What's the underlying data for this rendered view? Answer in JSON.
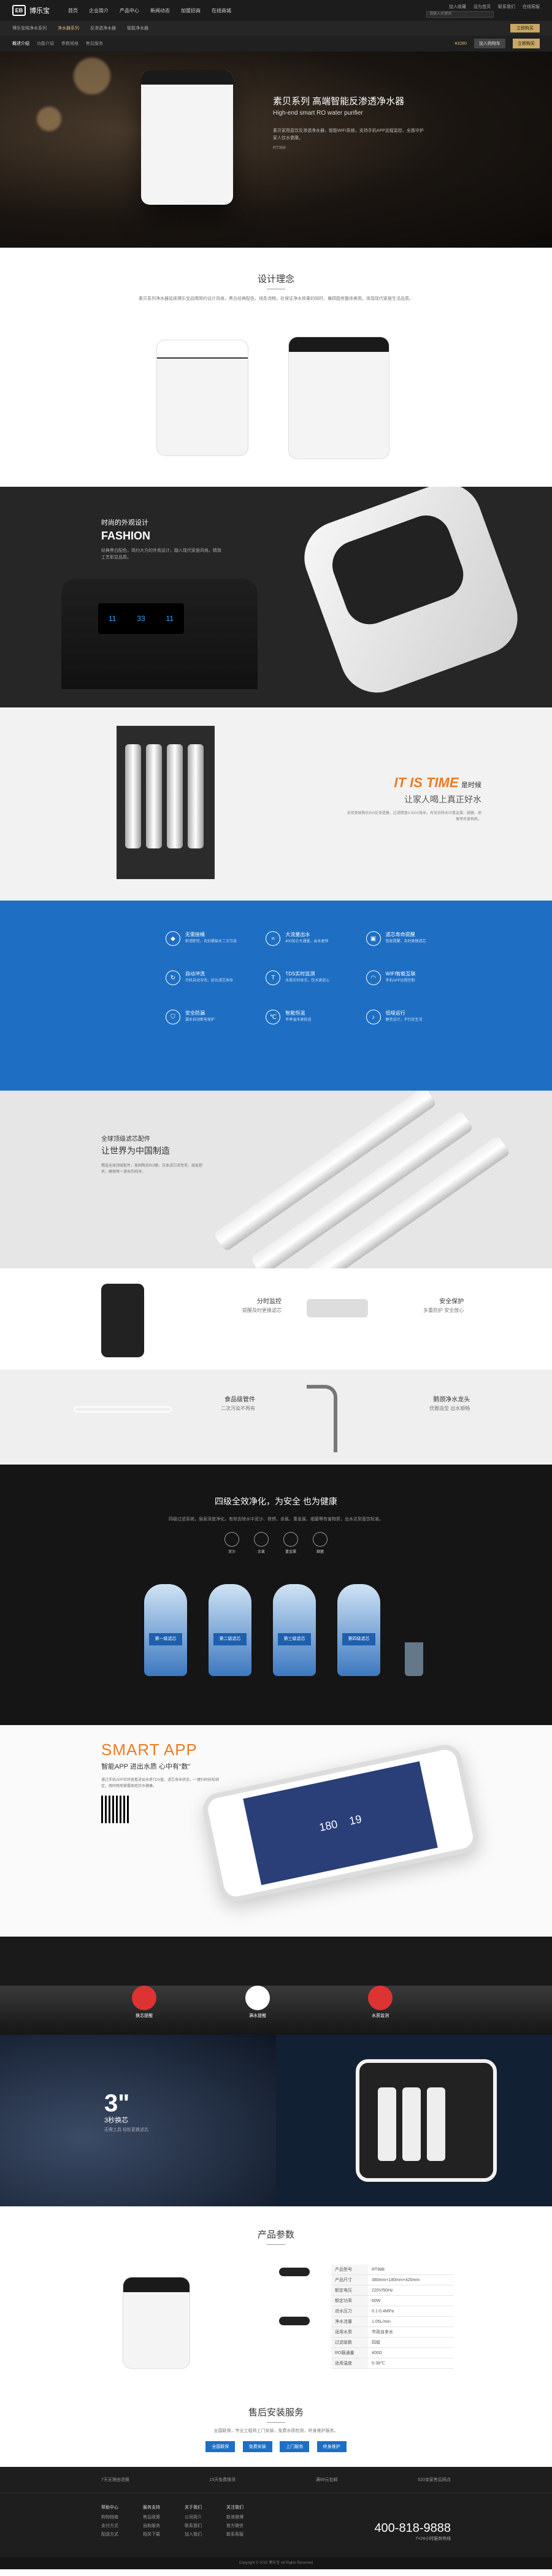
{
  "header": {
    "logo_text": "博乐宝",
    "logo_mark": "EB",
    "nav": [
      "首页",
      "企业简介",
      "产品中心",
      "新闻动态",
      "加盟招商",
      "在线商城"
    ],
    "top_right": [
      "加入收藏",
      "设为首页",
      "联系我们",
      "在线客服"
    ],
    "search_placeholder": "请输入关键词"
  },
  "subnav": {
    "items": [
      "博乐宝纯净水系列",
      "净水器系列",
      "反渗透净水器",
      "智能净水器"
    ],
    "active_index": 1,
    "buy_label": "立即购买"
  },
  "subnav2": {
    "label": "概述介绍",
    "items": [
      "功能介绍",
      "参数规格",
      "售后服务"
    ],
    "price": "¥3280",
    "btn1": "加入购物车",
    "btn2": "立即购买"
  },
  "hero": {
    "title": "素贝系列 高端智能反渗透净水器",
    "subtitle": "High-end smart RO water purifier",
    "desc": "素贝家用直饮反渗透净水器，智能WIFI系统，支持手机APP远程监控，全面守护家人饮水健康。",
    "model": "RT988"
  },
  "design": {
    "title": "设计理念",
    "desc": "素贝系列净水器延续博乐宝品牌简约设计风格，黑白经典配色，线条流畅，在保证净水效果的同时，兼顾厨房整体美观，体现现代家居生活品质。"
  },
  "fashion": {
    "title": "时尚的外观设计",
    "title_en": "FASHION",
    "desc": "经典黑白配色，简约大方的外观设计，融入现代家居风格，精致工艺彰显品质。",
    "screen_values": [
      "11",
      "33",
      "11"
    ]
  },
  "time": {
    "headline_en": "IT IS TIME",
    "headline_cn": "是时候",
    "sub": "让家人喝上真正好水",
    "desc": "采用美国陶氏RO反渗透膜，过滤精度0.0001微米，有效去除水中重金属、细菌、病毒等有害物质。"
  },
  "features": [
    {
      "icon": "drop-icon",
      "title": "无需接桶",
      "desc": "即滤即饮，告别桶装水二次污染"
    },
    {
      "icon": "water-icon",
      "title": "大流量出水",
      "desc": "400加仑大通量，出水更快"
    },
    {
      "icon": "filter-icon",
      "title": "滤芯寿命提醒",
      "desc": "智能提醒，及时更换滤芯"
    },
    {
      "icon": "wash-icon",
      "title": "自动冲洗",
      "desc": "开机自动冲洗，延长滤芯寿命"
    },
    {
      "icon": "tds-icon",
      "title": "TDS实时监测",
      "desc": "水质实时显示，饮水更放心"
    },
    {
      "icon": "wifi-icon",
      "title": "WIFI智能互联",
      "desc": "手机APP远程控制"
    },
    {
      "icon": "shield-icon",
      "title": "安全防漏",
      "desc": "漏水自动断电保护"
    },
    {
      "icon": "temp-icon",
      "title": "智能恒温",
      "desc": "冬季温水更舒适"
    },
    {
      "icon": "mute-icon",
      "title": "低噪运行",
      "desc": "静音设计，不打扰生活"
    }
  ],
  "global": {
    "title1": "全球顶级滤芯配件",
    "title2": "让世界为中国制造",
    "desc": "精选全球顶级配件，美国陶氏RO膜，日本进口活性炭，层层把关，确保每一滴水的纯净。"
  },
  "filter_row": {
    "left_title": "分时监控",
    "left_desc": "提醒及时更换滤芯",
    "right_title": "安全保护",
    "right_desc": "多重防护 安全放心"
  },
  "food_row": {
    "left_title": "食品级管件",
    "left_desc": "二次污染不再有",
    "right_title": "鹅颈净水龙头",
    "right_desc": "优雅造型 出水顺畅"
  },
  "four": {
    "title": "四级全效净化，为安全 也为健康",
    "desc": "四级过滤系统，层层深度净化，有效去除水中泥沙、铁锈、余氯、重金属、细菌等有害物质，出水达到直饮标准。",
    "icons": [
      "泥沙",
      "余氯",
      "重金属",
      "细菌"
    ],
    "stages": [
      "第一级滤芯",
      "第二级滤芯",
      "第三级滤芯",
      "第四级滤芯"
    ]
  },
  "app": {
    "title_en": "SMART APP",
    "title_cn": "智能APP 进出水质 心中有“数”",
    "desc": "通过手机APP实时查看进出水质TDS值、滤芯寿命状态，一键扫码轻松绑定，随时随地掌握家庭饮水健康。",
    "phone_values": [
      "180",
      "19"
    ]
  },
  "kitchen": {
    "items": [
      "换芯提醒",
      "满水提醒",
      "水质监测"
    ]
  },
  "three": {
    "big": "3\"",
    "title": "3秒换芯",
    "desc": "无需工具 轻松更换滤芯"
  },
  "params": {
    "title": "产品参数",
    "rows": [
      {
        "k": "产品型号",
        "v": "RT988"
      },
      {
        "k": "产品尺寸",
        "v": "380mm×180mm×420mm"
      },
      {
        "k": "额定电压",
        "v": "220V/50Hz"
      },
      {
        "k": "额定功率",
        "v": "60W"
      },
      {
        "k": "进水压力",
        "v": "0.1-0.4MPa"
      },
      {
        "k": "净水流量",
        "v": "1.05L/min"
      },
      {
        "k": "适用水质",
        "v": "市政自来水"
      },
      {
        "k": "过滤级数",
        "v": "四级"
      },
      {
        "k": "RO膜通量",
        "v": "400G"
      },
      {
        "k": "适用温度",
        "v": "5-38℃"
      }
    ]
  },
  "service": {
    "title": "售后安装服务",
    "desc": "全国联保，专业工程师上门安装，免费水质检测，终身维护服务。",
    "buttons": [
      "全国联保",
      "免费安装",
      "上门服务",
      "终身维护"
    ]
  },
  "footer": {
    "service_items": [
      "7天无理由退换",
      "15天免费换货",
      "满99元包邮",
      "520余家售后网点"
    ],
    "cols": [
      {
        "title": "帮助中心",
        "links": [
          "购物指南",
          "支付方式",
          "配送方式"
        ]
      },
      {
        "title": "服务支持",
        "links": [
          "售后政策",
          "自助服务",
          "相关下载"
        ]
      },
      {
        "title": "关于我们",
        "links": [
          "公司简介",
          "联系我们",
          "加入我们"
        ]
      },
      {
        "title": "关注我们",
        "links": [
          "新浪微博",
          "官方微信",
          "联系客服"
        ]
      }
    ],
    "hotline": "400-818-9888",
    "hotline_note": "7×24小时服务热线",
    "copyright": "Copyright © 2015 博乐宝 All Rights Reserved"
  }
}
